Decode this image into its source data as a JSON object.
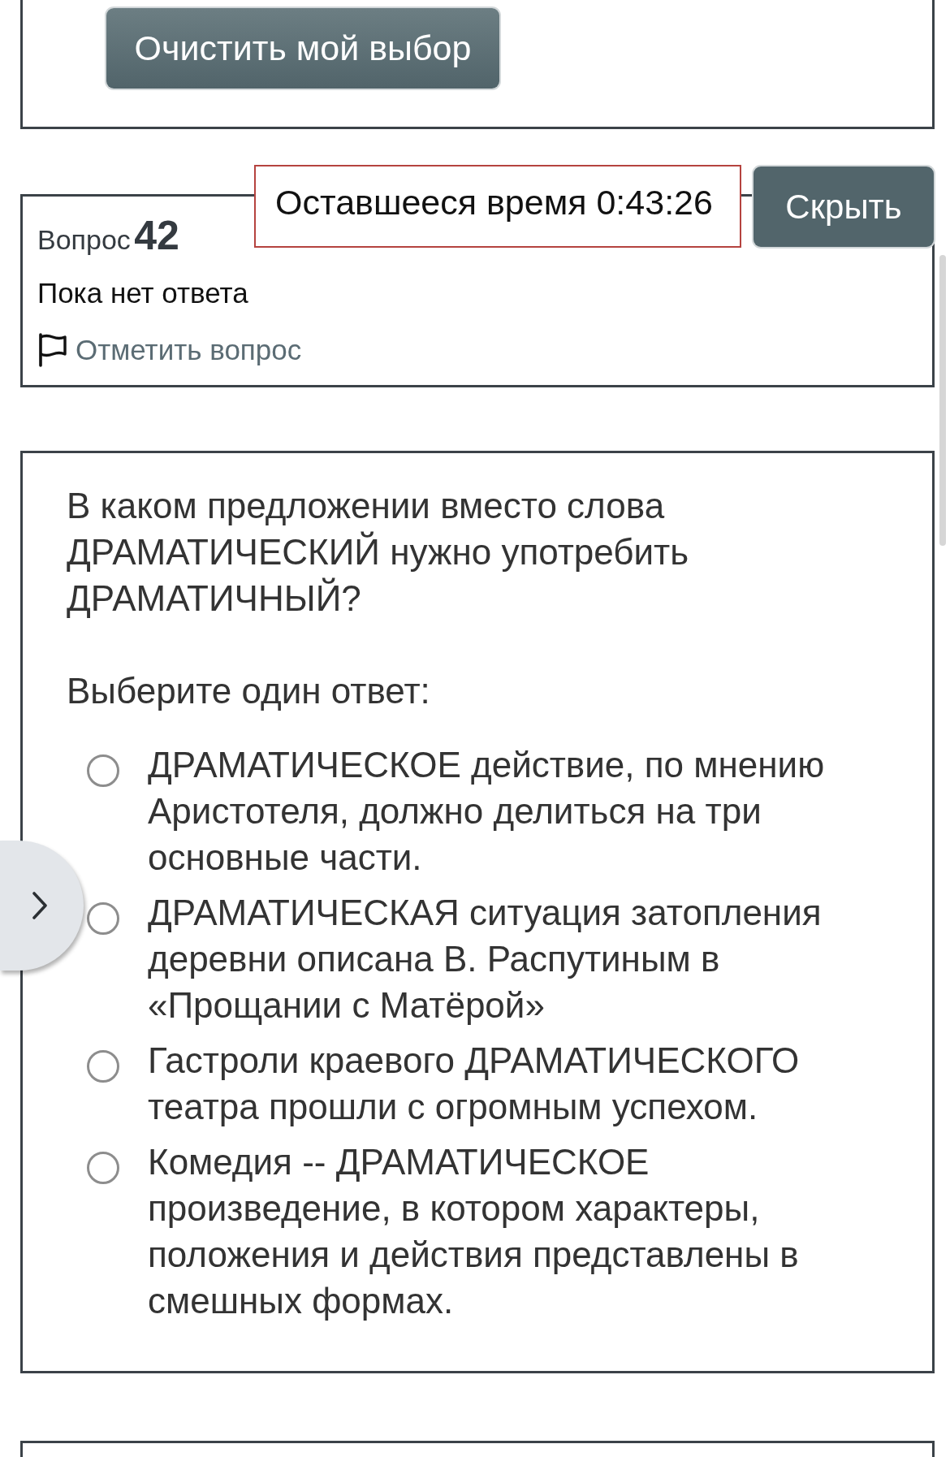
{
  "previous_question": {
    "clear_button": "Очистить мой выбор"
  },
  "timer": {
    "label": "Оставшееся время",
    "value": "0:43:26",
    "hide_button": "Скрыть"
  },
  "question_info": {
    "label": "Вопрос",
    "number": "42",
    "status": "Пока нет ответа",
    "flag_link": "Отметить вопрос"
  },
  "question": {
    "text": "В каком предложении вместо слова ДРАМАТИЧЕСКИЙ нужно употребить ДРАМАТИЧНЫЙ?",
    "prompt": "Выберите один ответ:",
    "options": [
      {
        "text": "ДРАМАТИЧЕСКОЕ действие, по мнению Аристотеля, должно делиться на три основные части.",
        "selected": false
      },
      {
        "text": "ДРАМАТИЧЕСКАЯ ситуация затопления деревни описана В. Распутиным в «Прощании с Матёрой»",
        "selected": false
      },
      {
        "text": "Гастроли краевого ДРАМАТИЧЕСКОГО театра прошли с огромным успехом.",
        "selected": false
      },
      {
        "text": "Комедия -- ДРАМАТИЧЕСКОЕ произведение, в котором характеры, положения и действия представлены в смешных формах.",
        "selected": false
      }
    ]
  }
}
